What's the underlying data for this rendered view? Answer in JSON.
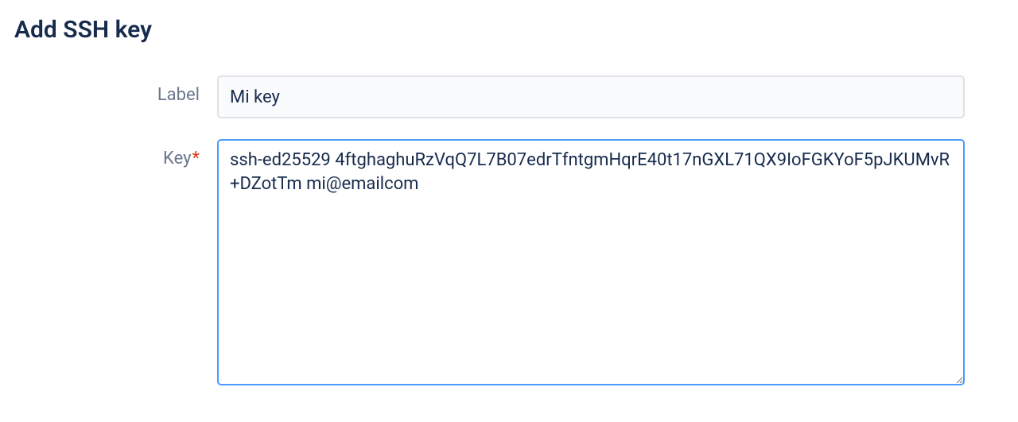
{
  "page": {
    "title": "Add SSH key"
  },
  "form": {
    "label": {
      "text": "Label",
      "required": false,
      "value": "Mi key"
    },
    "key": {
      "text": "Key",
      "required": true,
      "value": "ssh-ed25529 4ftghaghuRzVqQ7L7B07edrTfntgmHqrE40t17nGXL71QX9IoFGKYoF5pJKUMvR+DZotTm mi@emailcom"
    }
  }
}
